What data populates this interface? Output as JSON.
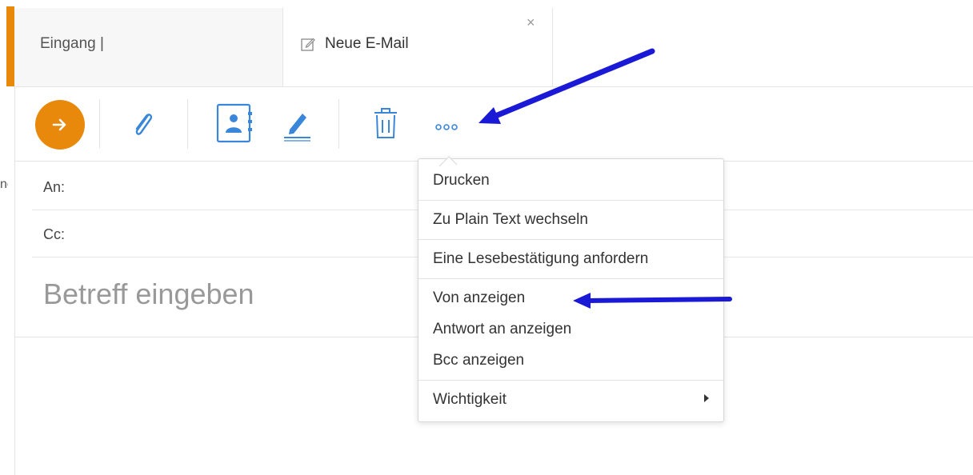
{
  "tabs": [
    {
      "label": "Eingang |"
    },
    {
      "label": "Neue E-Mail",
      "close": "×"
    }
  ],
  "left_clipped_text": "ne",
  "toolbar": {
    "send": "send-arrow-icon",
    "buttons": [
      "paperclip-icon",
      "address-book-icon",
      "signature-pen-icon",
      "trash-icon",
      "more-options-icon"
    ],
    "more_label": "∘∘∘"
  },
  "fields": {
    "to_label": "An:",
    "cc_label": "Cc:",
    "subject_placeholder": "Betreff eingeben"
  },
  "more_menu": {
    "items": [
      {
        "label": "Drucken"
      },
      {
        "label": "Zu Plain Text wechseln"
      },
      {
        "label": "Eine Lesebestätigung anfordern"
      },
      {
        "label": "Von anzeigen"
      },
      {
        "label": "Antwort an anzeigen"
      },
      {
        "label": "Bcc anzeigen"
      },
      {
        "label": "Wichtigkeit",
        "submenu": true
      }
    ]
  },
  "colors": {
    "accent": "#e8890c",
    "icon_blue": "#3a86d9",
    "annotation_arrow": "#1a1ad6"
  }
}
